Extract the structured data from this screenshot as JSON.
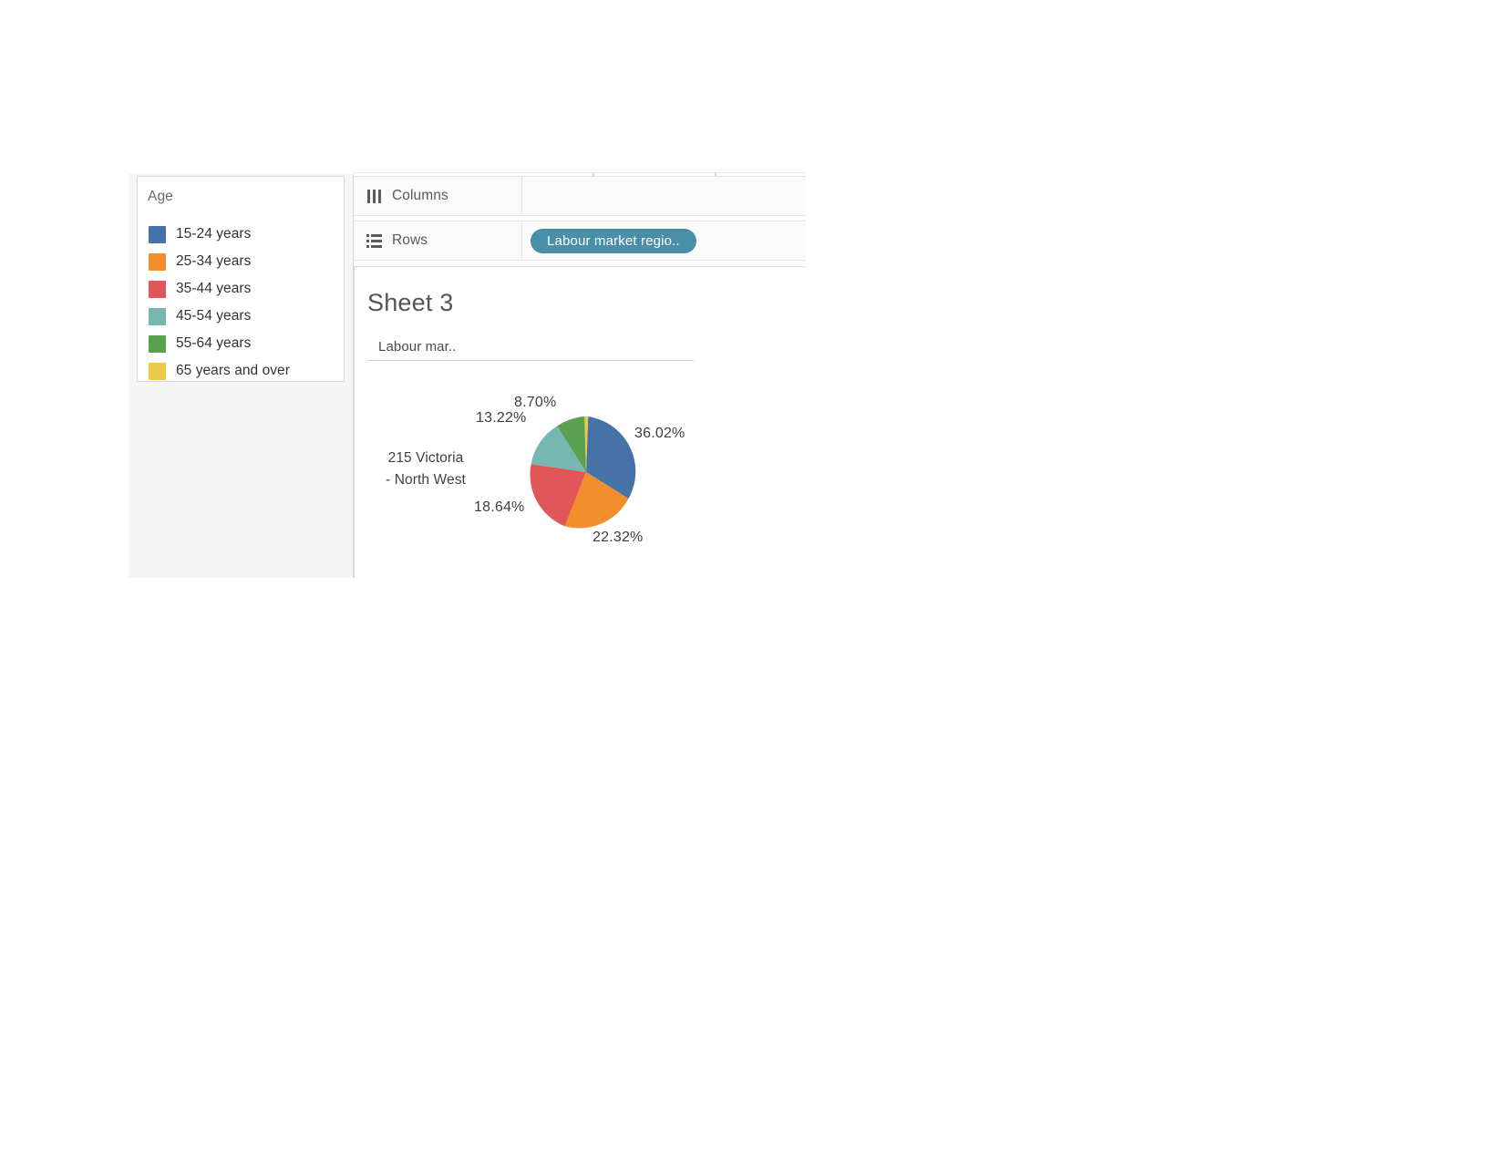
{
  "legend": {
    "title": "Age",
    "items": [
      {
        "label": "15-24 years",
        "color": "#4572a7"
      },
      {
        "label": "25-34 years",
        "color": "#f28e2b"
      },
      {
        "label": "35-44 years",
        "color": "#e15759"
      },
      {
        "label": "45-54 years",
        "color": "#76b7b2"
      },
      {
        "label": "55-64 years",
        "color": "#59a14f"
      },
      {
        "label": "65 years and over",
        "color": "#edc948"
      }
    ]
  },
  "shelves": {
    "columns": {
      "label": "Columns",
      "icon": "columns-icon",
      "pills": []
    },
    "rows": {
      "label": "Rows",
      "icon": "rows-icon",
      "pill": "Labour market regio.."
    }
  },
  "worksheet": {
    "title": "Sheet 3",
    "column_header": "Labour mar..",
    "row_label_line1": "215 Victoria",
    "row_label_line2": "- North West"
  },
  "chart_data": {
    "type": "pie",
    "title": "Sheet 3",
    "row_label": "215 Victoria - North West",
    "legend_title": "Age",
    "legend_position": "left",
    "categories": [
      "15-24 years",
      "25-34 years",
      "35-44 years",
      "45-54 years",
      "55-64 years",
      "65 years and over"
    ],
    "values": [
      36.02,
      22.32,
      18.64,
      13.22,
      8.7,
      1.1
    ],
    "value_unit": "percent",
    "colors": [
      "#4572a7",
      "#f28e2b",
      "#e15759",
      "#76b7b2",
      "#59a14f",
      "#edc948"
    ],
    "labels": [
      {
        "text": "36.02%",
        "category": "15-24 years"
      },
      {
        "text": "22.32%",
        "category": "25-34 years"
      },
      {
        "text": "18.64%",
        "category": "35-44 years"
      },
      {
        "text": "13.22%",
        "category": "45-54 years"
      },
      {
        "text": "8.70%",
        "category": "55-64 years"
      }
    ],
    "labels_shown": [
      "36.02%",
      "22.32%",
      "18.64%",
      "13.22%",
      "8.70%"
    ]
  },
  "pie_labels": {
    "p1": "36.02%",
    "p2": "22.32%",
    "p3": "18.64%",
    "p4": "13.22%",
    "p5": "8.70%"
  }
}
